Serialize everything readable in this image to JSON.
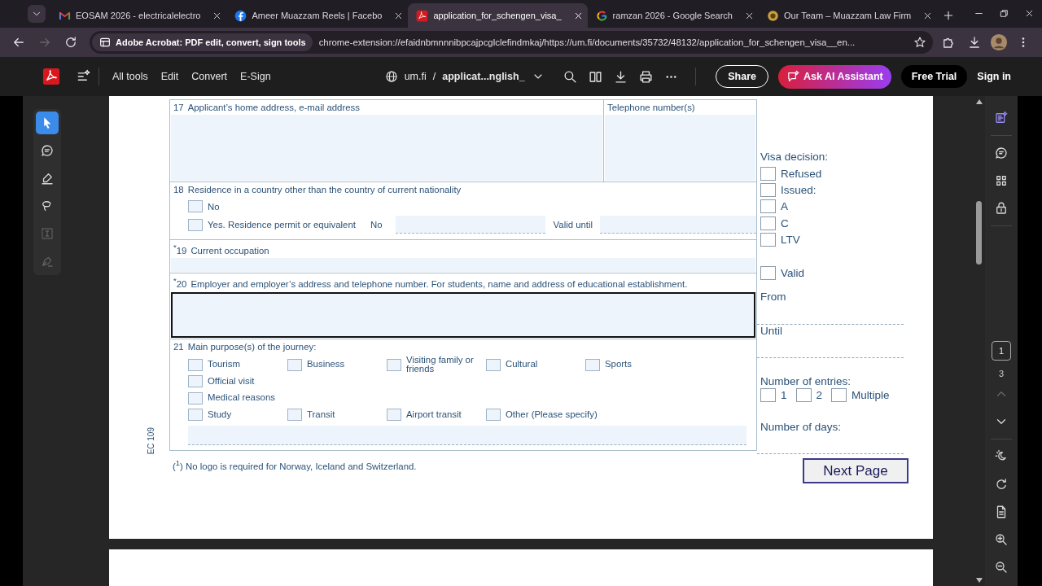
{
  "browser": {
    "tabs": [
      {
        "kind": "mail",
        "title": "EOSAM 2026 - electricalelectro",
        "selected": false
      },
      {
        "kind": "facebook",
        "title": "Ameer Muazzam Reels | Facebo",
        "selected": false
      },
      {
        "kind": "pdf",
        "title": "application_for_schengen_visa_",
        "selected": true
      },
      {
        "kind": "google",
        "title": "ramzan 2026 - Google Search",
        "selected": false
      },
      {
        "kind": "badge",
        "title": "Our Team – Muazzam Law Firm",
        "selected": false
      }
    ],
    "site_chip": "Adobe Acrobat: PDF edit, convert, sign tools",
    "url": "chrome-extension://efaidnbmnnnibpcajpcglclefindmkaj/https://um.fi/documents/35732/48132/application_for_schengen_visa__en..."
  },
  "toolbar": {
    "menu": [
      "All tools",
      "Edit",
      "Convert",
      "E-Sign"
    ],
    "domain": "um.fi",
    "path_separator": "/",
    "file_name": "applicat...nglish_",
    "share": "Share",
    "ai_assistant": "Ask AI Assistant",
    "free_trial": "Free Trial",
    "sign_in": "Sign in"
  },
  "tools": [
    {
      "kind": "select",
      "selected": true,
      "disabled": false
    },
    {
      "kind": "comment",
      "selected": false,
      "disabled": false
    },
    {
      "kind": "highlight",
      "selected": false,
      "disabled": false
    },
    {
      "kind": "draw",
      "selected": false,
      "disabled": false
    },
    {
      "kind": "text",
      "selected": false,
      "disabled": true
    },
    {
      "kind": "sign",
      "selected": false,
      "disabled": true
    }
  ],
  "page_nav": {
    "current": "1",
    "total": "3"
  },
  "form": {
    "side_label": "EC 109",
    "q17": {
      "number": "17",
      "label": "Applicant’s home address, e-mail address",
      "phone_label": "Telephone number(s)"
    },
    "q18": {
      "number": "18",
      "label": "Residence in a country other than the country of current nationality",
      "options": [
        {
          "label": "No",
          "checked": false
        },
        {
          "label": "Yes. Residence permit or equivalent",
          "checked": false
        }
      ],
      "permit_no_label": "No",
      "valid_until_label": "Valid until"
    },
    "q19": {
      "number": "$^{*}$19",
      "label": "Current occupation"
    },
    "q20": {
      "number": "$^{*}$20",
      "label": "Employer and employer’s address and telephone number. For students, name and address of educational establishment.",
      "focused": true
    },
    "q21": {
      "number": "21",
      "label": "Main purpose(s) of the journey:",
      "rows": [
        [
          {
            "label": "Tourism",
            "checked": false
          },
          {
            "label": "Business",
            "checked": false
          },
          {
            "label": "Visiting family or friends",
            "checked": false
          },
          {
            "label": "Cultural",
            "checked": false
          },
          {
            "label": "Sports",
            "checked": false
          }
        ],
        [
          {
            "label": "Official visit",
            "checked": false
          }
        ],
        [
          {
            "label": "Medical reasons",
            "checked": false
          }
        ],
        [
          {
            "label": "Study",
            "checked": false
          },
          {
            "label": "Transit",
            "checked": false
          },
          {
            "label": "Airport transit",
            "checked": false
          },
          {
            "label": "Other (Please specify)",
            "checked": false
          }
        ]
      ]
    },
    "footnote": "($^{1}$) No logo is required for Norway, Iceland and Switzerland."
  },
  "decision": {
    "heading": "Visa decision:",
    "options": [
      {
        "label": "Refused",
        "checked": false
      },
      {
        "label": "Issued:",
        "checked": false
      },
      {
        "label": "A",
        "checked": false
      },
      {
        "label": "C",
        "checked": false
      },
      {
        "label": "LTV",
        "checked": false
      }
    ],
    "valid": {
      "label": "Valid",
      "checked": false
    },
    "from_label": "From",
    "until_label": "Until",
    "entries_label": "Number of entries:",
    "entries": [
      {
        "label": "1",
        "checked": false
      },
      {
        "label": "2",
        "checked": false
      },
      {
        "label": "Multiple",
        "checked": false
      }
    ],
    "days_label": "Number of days:"
  },
  "next_page": "Next Page"
}
